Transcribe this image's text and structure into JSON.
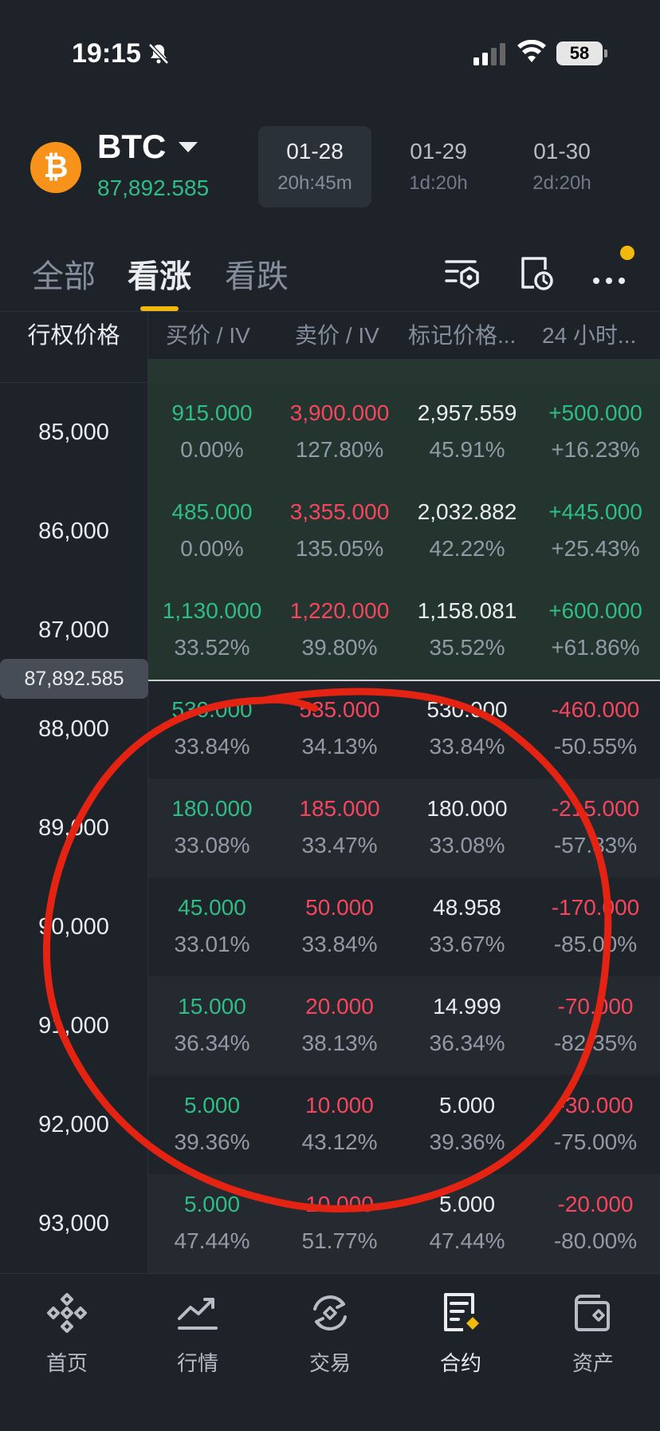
{
  "status_bar": {
    "time": "19:15",
    "battery": "58"
  },
  "header": {
    "coin": "BTC",
    "coin_icon": "bitcoin-icon",
    "index_price": "87,892.585",
    "expiries": [
      {
        "date": "01-28",
        "countdown": "20h:45m",
        "active": true
      },
      {
        "date": "01-29",
        "countdown": "1d:20h",
        "active": false
      },
      {
        "date": "01-30",
        "countdown": "2d:20h",
        "active": false
      }
    ]
  },
  "tabs": [
    {
      "label": "全部",
      "active": false
    },
    {
      "label": "看涨",
      "active": true
    },
    {
      "label": "看跌",
      "active": false
    }
  ],
  "columns": {
    "strike": "行权价格",
    "bid": "买价 / IV",
    "ask": "卖价 / IV",
    "mark": "标记价格...",
    "change": "24 小时..."
  },
  "current_price_tag": "87,892.585",
  "rows": [
    {
      "strike": "85,000",
      "bid": "915.000",
      "bid_iv": "0.00%",
      "ask": "3,900.000",
      "ask_iv": "127.80%",
      "mark": "2,957.559",
      "mark_iv": "45.91%",
      "chg": "+500.000",
      "chg_pct": "+16.23%"
    },
    {
      "strike": "86,000",
      "bid": "485.000",
      "bid_iv": "0.00%",
      "ask": "3,355.000",
      "ask_iv": "135.05%",
      "mark": "2,032.882",
      "mark_iv": "42.22%",
      "chg": "+445.000",
      "chg_pct": "+25.43%"
    },
    {
      "strike": "87,000",
      "bid": "1,130.000",
      "bid_iv": "33.52%",
      "ask": "1,220.000",
      "ask_iv": "39.80%",
      "mark": "1,158.081",
      "mark_iv": "35.52%",
      "chg": "+600.000",
      "chg_pct": "+61.86%"
    },
    {
      "strike": "88,000",
      "bid": "530.000",
      "bid_iv": "33.84%",
      "ask": "535.000",
      "ask_iv": "34.13%",
      "mark": "530.000",
      "mark_iv": "33.84%",
      "chg": "-460.000",
      "chg_pct": "-50.55%"
    },
    {
      "strike": "89,000",
      "bid": "180.000",
      "bid_iv": "33.08%",
      "ask": "185.000",
      "ask_iv": "33.47%",
      "mark": "180.000",
      "mark_iv": "33.08%",
      "chg": "-215.000",
      "chg_pct": "-57.33%"
    },
    {
      "strike": "90,000",
      "bid": "45.000",
      "bid_iv": "33.01%",
      "ask": "50.000",
      "ask_iv": "33.84%",
      "mark": "48.958",
      "mark_iv": "33.67%",
      "chg": "-170.000",
      "chg_pct": "-85.00%"
    },
    {
      "strike": "91,000",
      "bid": "15.000",
      "bid_iv": "36.34%",
      "ask": "20.000",
      "ask_iv": "38.13%",
      "mark": "14.999",
      "mark_iv": "36.34%",
      "chg": "-70.000",
      "chg_pct": "-82.35%"
    },
    {
      "strike": "92,000",
      "bid": "5.000",
      "bid_iv": "39.36%",
      "ask": "10.000",
      "ask_iv": "43.12%",
      "mark": "5.000",
      "mark_iv": "39.36%",
      "chg": "-30.000",
      "chg_pct": "-75.00%"
    },
    {
      "strike": "93,000",
      "bid": "5.000",
      "bid_iv": "47.44%",
      "ask": "10.000",
      "ask_iv": "51.77%",
      "mark": "5.000",
      "mark_iv": "47.44%",
      "chg": "-20.000",
      "chg_pct": "-80.00%"
    }
  ],
  "bottom_nav": [
    {
      "label": "首页",
      "icon": "home-diamond-icon",
      "active": false
    },
    {
      "label": "行情",
      "icon": "market-chart-icon",
      "active": false
    },
    {
      "label": "交易",
      "icon": "trade-swap-icon",
      "active": false
    },
    {
      "label": "合约",
      "icon": "futures-doc-icon",
      "active": true
    },
    {
      "label": "资产",
      "icon": "wallet-icon",
      "active": false
    }
  ],
  "colors": {
    "up": "#2ebd85",
    "down": "#f6465d",
    "accent": "#f0b90b",
    "background": "#1e2329"
  }
}
